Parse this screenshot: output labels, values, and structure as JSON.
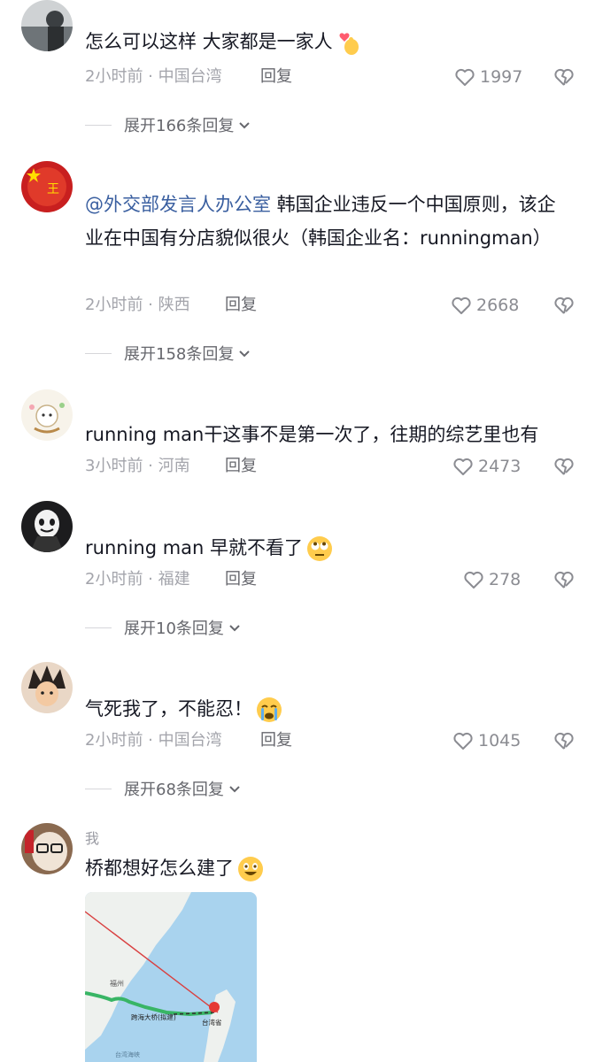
{
  "comments": [
    {
      "text": "怎么可以这样 大家都是一家人",
      "time_location": "2小时前 · 中国台湾",
      "reply": "回复",
      "likes": "1997",
      "expand": "展开166条回复"
    },
    {
      "mention": "@外交部发言人办公室",
      "text": " 韩国企业违反一个中国原则，该企业在中国有分店貌似很火（韩国企业名：runningman）",
      "time_location": "2小时前 · 陕西",
      "reply": "回复",
      "likes": "2668",
      "expand": "展开158条回复"
    },
    {
      "text": "running man干这事不是第一次了，往期的综艺里也有",
      "time_location": "3小时前 · 河南",
      "reply": "回复",
      "likes": "2473"
    },
    {
      "text": "running man 早就不看了",
      "time_location": "2小时前 · 福建",
      "reply": "回复",
      "likes": "278",
      "expand": "展开10条回复"
    },
    {
      "text": "气死我了，不能忍！",
      "time_location": "2小时前 · 中国台湾",
      "reply": "回复",
      "likes": "1045",
      "expand": "展开68条回复"
    },
    {
      "username": "我",
      "text": "桥都想好怎么建了",
      "map_labels": {
        "fuzhou": "福州",
        "bridge": "跨海大桥(拟建)",
        "taiwan": "台湾省",
        "strait": "台湾海峡"
      }
    }
  ],
  "colors": {
    "mention": "#3a5fa0",
    "meta": "#a3a4ab",
    "text": "#161823"
  }
}
